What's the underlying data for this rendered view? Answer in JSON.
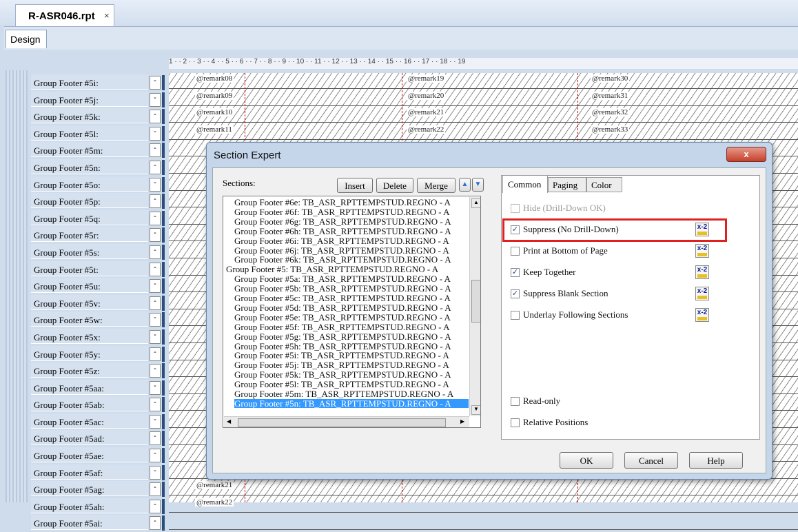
{
  "document_tab": {
    "label": "R-ASR046.rpt",
    "close": "×"
  },
  "design_tab": "Design",
  "ruler": "1 · · 2 · · 3 · · 4 · · 5 · · 6 · · 7 · · 8 · · 9 · · 10 · · 11 · · 12 · · 13 · · 14 · · 15 · · 16 · · 17 · · 18 · · 19",
  "group_rows": [
    "Group Footer #5i:",
    "Group Footer #5j:",
    "Group Footer #5k:",
    "Group Footer #5l:",
    "Group Footer #5m:",
    "Group Footer #5n:",
    "Group Footer #5o:",
    "Group Footer #5p:",
    "Group Footer #5q:",
    "Group Footer #5r:",
    "Group Footer #5s:",
    "Group Footer #5t:",
    "Group Footer #5u:",
    "Group Footer #5v:",
    "Group Footer #5w:",
    "Group Footer #5x:",
    "Group Footer #5y:",
    "Group Footer #5z:",
    "Group Footer #5aa:",
    "Group Footer #5ab:",
    "Group Footer #5ac:",
    "Group Footer #5ad:",
    "Group Footer #5ae:",
    "Group Footer #5af:",
    "Group Footer #5ag:",
    "Group Footer #5ah:",
    "Group Footer #5ai:"
  ],
  "row_marker": "-",
  "canvas_fields": {
    "col1": [
      "@remark08",
      "@remark09",
      "@remark10",
      "@remark11"
    ],
    "col2": [
      "@remark19",
      "@remark20",
      "@remark21",
      "@remark22"
    ],
    "col3": [
      "@remark30",
      "@remark31",
      "@remark32",
      "@remark33"
    ],
    "bottom": [
      "@remark21",
      "@remark22"
    ]
  },
  "dialog": {
    "title": "Section Expert",
    "close": "x",
    "sections_label": "Sections:",
    "buttons": {
      "insert": "Insert",
      "delete": "Delete",
      "merge": "Merge"
    },
    "sections": [
      "Group Footer #6e: TB_ASR_RPTTEMPSTUD.REGNO - A",
      "Group Footer #6f: TB_ASR_RPTTEMPSTUD.REGNO - A",
      "Group Footer #6g: TB_ASR_RPTTEMPSTUD.REGNO - A",
      "Group Footer #6h: TB_ASR_RPTTEMPSTUD.REGNO - A",
      "Group Footer #6i: TB_ASR_RPTTEMPSTUD.REGNO - A",
      "Group Footer #6j: TB_ASR_RPTTEMPSTUD.REGNO - A",
      "Group Footer #6k: TB_ASR_RPTTEMPSTUD.REGNO - A",
      "Group Footer #5: TB_ASR_RPTTEMPSTUD.REGNO - A",
      "Group Footer #5a: TB_ASR_RPTTEMPSTUD.REGNO - A",
      "Group Footer #5b: TB_ASR_RPTTEMPSTUD.REGNO - A",
      "Group Footer #5c: TB_ASR_RPTTEMPSTUD.REGNO - A",
      "Group Footer #5d: TB_ASR_RPTTEMPSTUD.REGNO - A",
      "Group Footer #5e: TB_ASR_RPTTEMPSTUD.REGNO - A",
      "Group Footer #5f: TB_ASR_RPTTEMPSTUD.REGNO - A",
      "Group Footer #5g: TB_ASR_RPTTEMPSTUD.REGNO - A",
      "Group Footer #5h: TB_ASR_RPTTEMPSTUD.REGNO - A",
      "Group Footer #5i: TB_ASR_RPTTEMPSTUD.REGNO - A",
      "Group Footer #5j: TB_ASR_RPTTEMPSTUD.REGNO - A",
      "Group Footer #5k: TB_ASR_RPTTEMPSTUD.REGNO - A",
      "Group Footer #5l: TB_ASR_RPTTEMPSTUD.REGNO - A",
      "Group Footer #5m: TB_ASR_RPTTEMPSTUD.REGNO - A",
      "Group Footer #5n: TB_ASR_RPTTEMPSTUD.REGNO - A"
    ],
    "selected_section": "Group Footer #5n: TB_ASR_RPTTEMPSTUD.REGNO - A",
    "tabs": [
      "Common",
      "Paging",
      "Color"
    ],
    "active_tab": "Common",
    "options": [
      {
        "label": "Hide (Drill-Down OK)",
        "checked": false,
        "disabled": true,
        "formula": false
      },
      {
        "label": "Suppress (No Drill-Down)",
        "checked": true,
        "disabled": false,
        "formula": true,
        "highlighted": true
      },
      {
        "label": "Print at Bottom of Page",
        "checked": false,
        "disabled": false,
        "formula": true
      },
      {
        "label": "Keep Together",
        "checked": true,
        "disabled": false,
        "formula": true
      },
      {
        "label": "Suppress Blank Section",
        "checked": true,
        "disabled": false,
        "formula": true
      },
      {
        "label": "Underlay Following Sections",
        "checked": false,
        "disabled": false,
        "formula": true
      }
    ],
    "lower_options": [
      {
        "label": "Read-only",
        "checked": false
      },
      {
        "label": "Relative Positions",
        "checked": false
      }
    ],
    "formula_icon_text": "x-2",
    "footer_buttons": {
      "ok": "OK",
      "cancel": "Cancel",
      "help": "Help"
    },
    "highlight_color": "#e02020",
    "selection_color": "#3399ff"
  }
}
